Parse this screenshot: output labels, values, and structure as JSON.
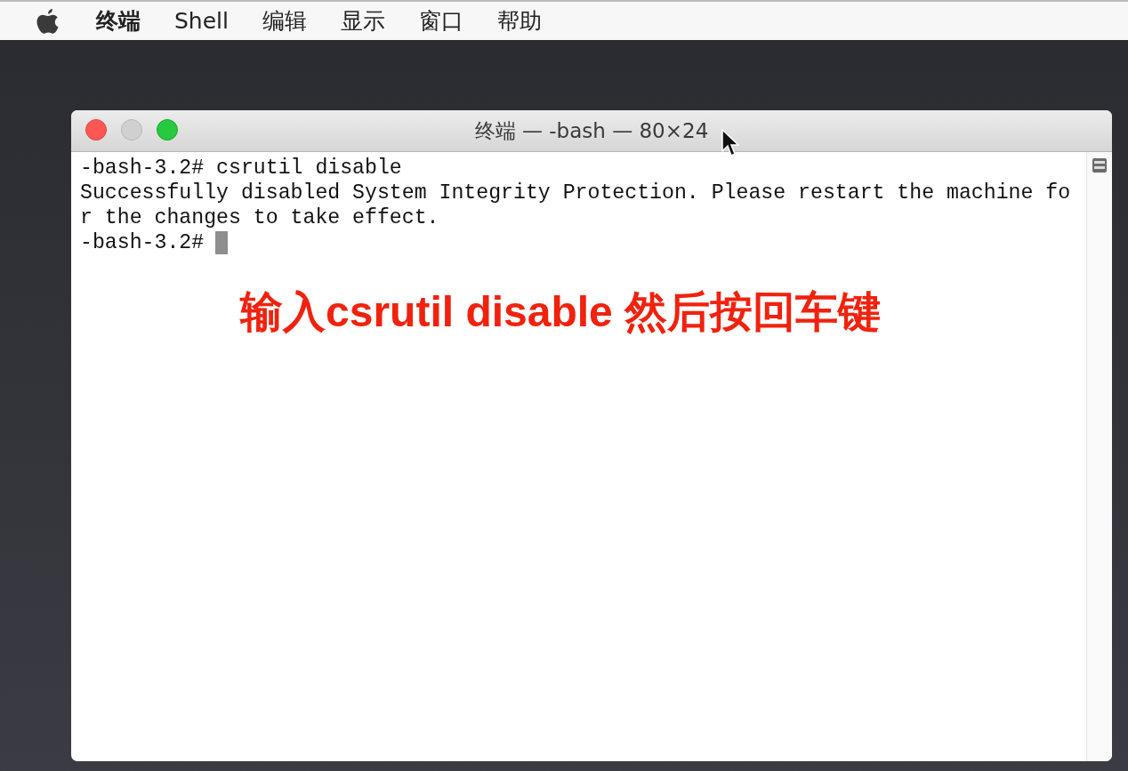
{
  "menu_bar": {
    "items": [
      {
        "label": "终端",
        "bold": true
      },
      {
        "label": "Shell",
        "bold": false
      },
      {
        "label": "编辑",
        "bold": false
      },
      {
        "label": "显示",
        "bold": false
      },
      {
        "label": "窗口",
        "bold": false
      },
      {
        "label": "帮助",
        "bold": false
      }
    ]
  },
  "window": {
    "title": "终端 — -bash — 80×24",
    "traffic_lights": [
      {
        "kind": "close",
        "disabled": false
      },
      {
        "kind": "minimize",
        "disabled": true
      },
      {
        "kind": "zoom",
        "disabled": false
      }
    ],
    "lines": [
      {
        "text": "-bash-3.2# csrutil disable",
        "cursor": false
      },
      {
        "text": "Successfully disabled System Integrity Protection. Please restart the machine fo",
        "cursor": false
      },
      {
        "text": "r the changes to take effect.",
        "cursor": false
      },
      {
        "text": "-bash-3.2#",
        "cursor": true
      }
    ],
    "annotation": "输入csrutil disable 然后按回车键"
  }
}
